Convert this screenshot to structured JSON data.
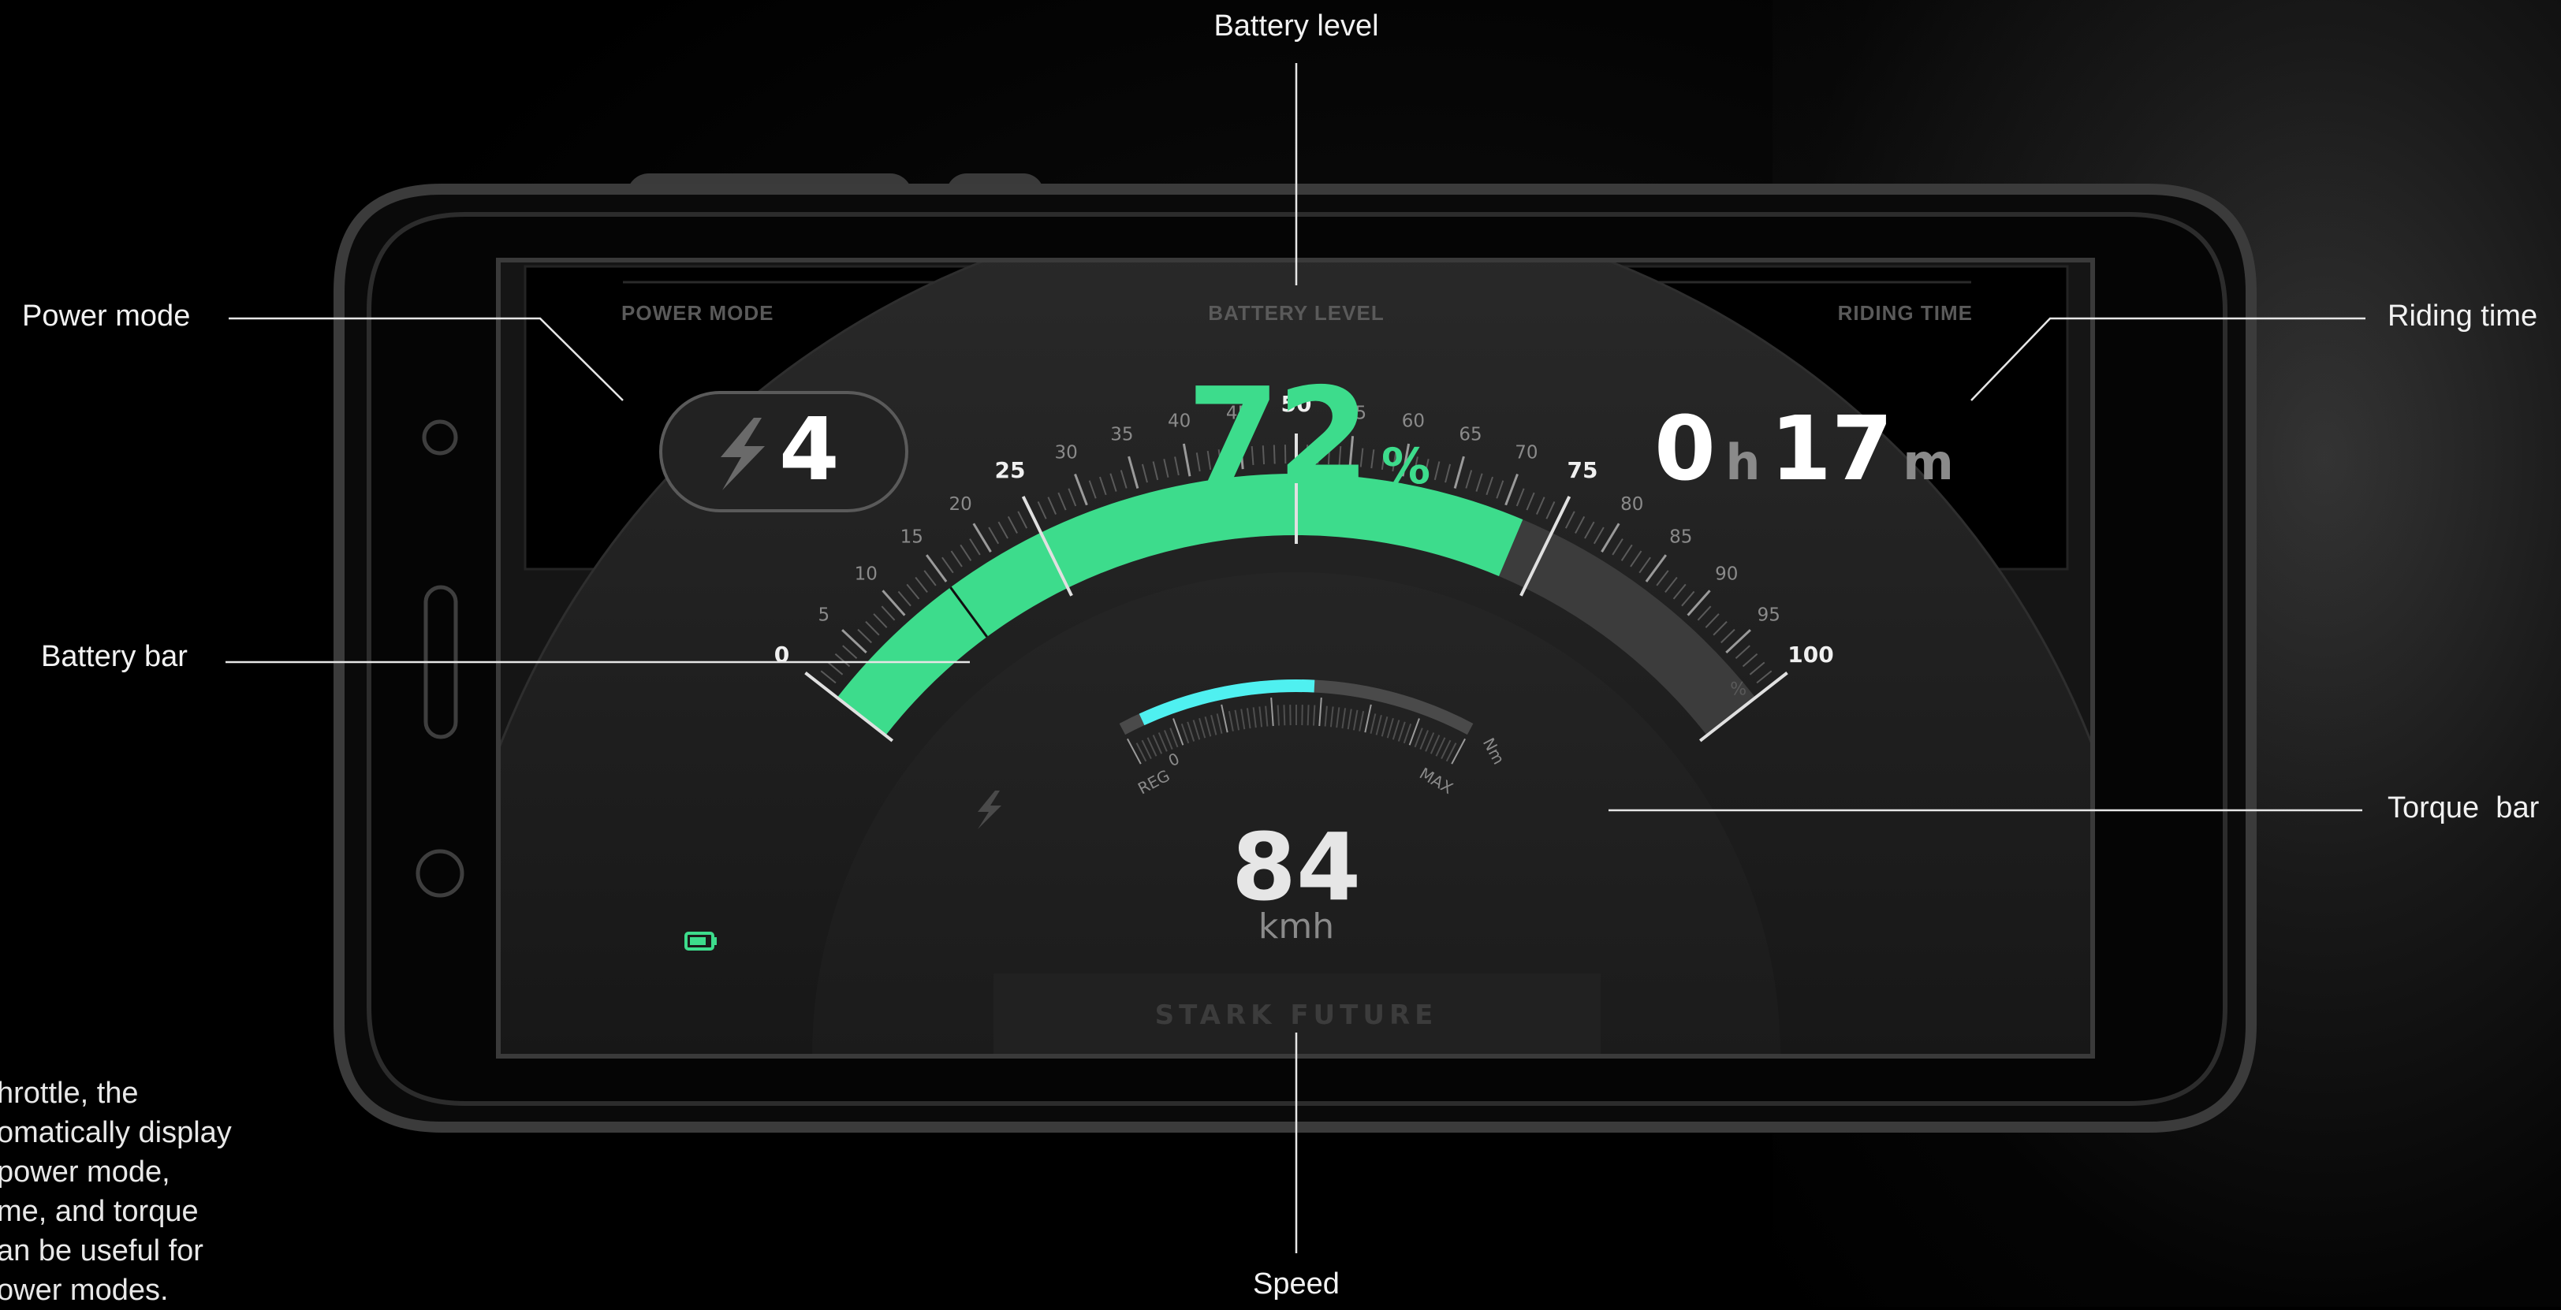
{
  "callouts": {
    "battery_level": "Battery level",
    "power_mode": "Power mode",
    "riding_time": "Riding time",
    "battery_bar": "Battery bar",
    "torque_bar": "Torque  bar",
    "speed": "Speed"
  },
  "side_note_lines": [
    "hrottle, the",
    "omatically display",
    "power mode,",
    "me, and torque",
    "an be useful for",
    "ower modes."
  ],
  "dashboard": {
    "power_mode": {
      "label": "POWER MODE",
      "value": "4",
      "icon": "lightning-icon"
    },
    "battery_level": {
      "label": "BATTERY LEVEL",
      "value": "72",
      "unit": "%"
    },
    "riding_time": {
      "label": "RIDING TIME",
      "hours": "0",
      "hours_unit": "h",
      "minutes": "17",
      "minutes_unit": "m"
    },
    "speed": {
      "value": "84",
      "unit": "kmh"
    },
    "brand": "STARK FUTURE",
    "battery_gauge": {
      "ticks": [
        "0",
        "5",
        "10",
        "15",
        "20",
        "25",
        "30",
        "35",
        "40",
        "45",
        "50",
        "55",
        "60",
        "65",
        "70",
        "75",
        "80",
        "85",
        "90",
        "95",
        "100"
      ],
      "unit": "%",
      "level": 72
    },
    "torque_gauge": {
      "labels": {
        "regen": "REG",
        "zero": "0",
        "max": "MAX",
        "unit": "Nm"
      },
      "level": 0.55
    }
  },
  "colors": {
    "accent_green": "#3ddc8c",
    "torque_cyan": "#4ff0f0",
    "panel": "#141414"
  }
}
